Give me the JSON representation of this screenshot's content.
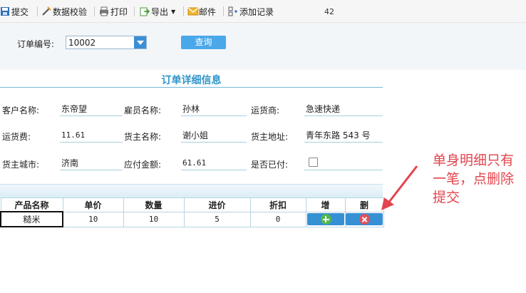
{
  "toolbar": {
    "items": [
      {
        "label": "提交",
        "icon": "submit-icon"
      },
      {
        "label": "数据校验",
        "icon": "check-icon"
      },
      {
        "label": "打印",
        "icon": "print-icon"
      },
      {
        "label": "导出",
        "icon": "export-icon"
      },
      {
        "label": "邮件",
        "icon": "mail-icon"
      },
      {
        "label": "添加记录",
        "icon": "add-record-icon"
      }
    ],
    "count": "42"
  },
  "query": {
    "label": "订单编号:",
    "order_id": "10002",
    "button": "查询"
  },
  "form": {
    "title": "订单详细信息",
    "fields": [
      {
        "label": "客户名称:",
        "value": "东帝望"
      },
      {
        "label": "雇员名称:",
        "value": "孙林"
      },
      {
        "label": "运货商:",
        "value": "急速快递"
      },
      {
        "label": "运货费:",
        "value": "11.61"
      },
      {
        "label": "货主名称:",
        "value": "谢小姐"
      },
      {
        "label": "货主地址:",
        "value": "青年东路 543 号"
      },
      {
        "label": "货主城市:",
        "value": "济南"
      },
      {
        "label": "应付金额:",
        "value": "61.61"
      },
      {
        "label": "是否已付:",
        "value": ""
      }
    ]
  },
  "grid": {
    "headers": [
      "产品名称",
      "单价",
      "数量",
      "进价",
      "折扣",
      "增",
      "删"
    ],
    "rows": [
      [
        "糙米",
        "10",
        "10",
        "5",
        "0"
      ]
    ]
  },
  "colors": {
    "accent": "#2e95c8",
    "button": "#4aa8ea",
    "annotation": "#e2454d"
  },
  "annotation": {
    "text": "单身明细只有一笔，点删除提交"
  }
}
